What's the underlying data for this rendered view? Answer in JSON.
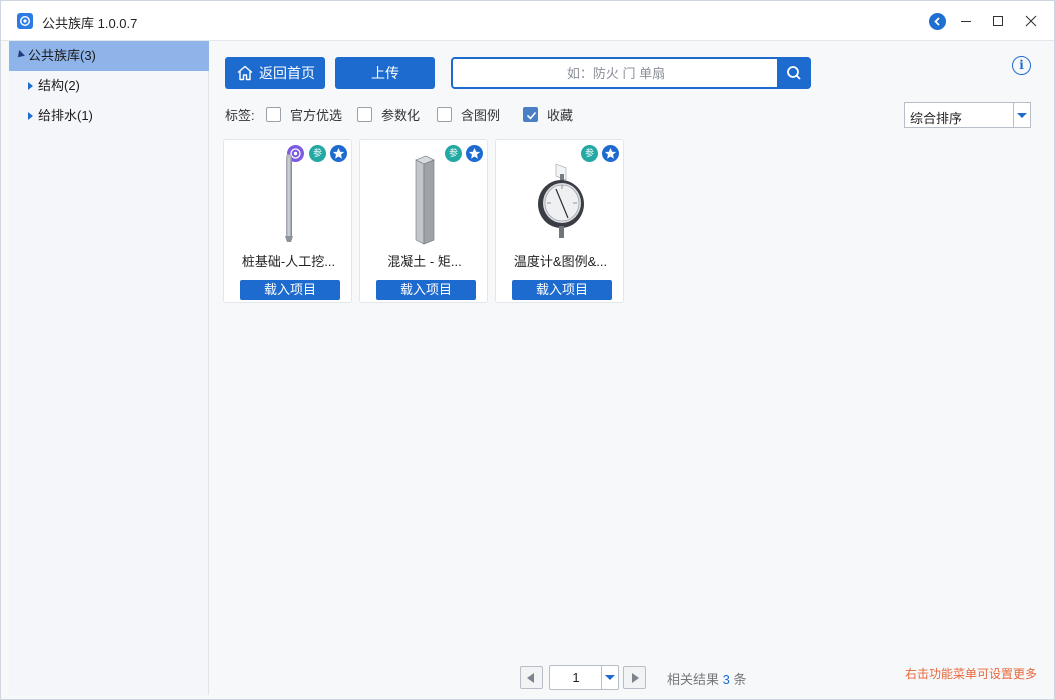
{
  "window": {
    "title": "公共族库 1.0.0.7"
  },
  "sidebar": {
    "root": {
      "label": "公共族库(3)"
    },
    "items": [
      {
        "label": "结构(2)"
      },
      {
        "label": "给排水(1)"
      }
    ]
  },
  "toolbar": {
    "home_label": "返回首页",
    "upload_label": "上传",
    "search_placeholder": "如：防火 门 单扇"
  },
  "tags": {
    "label": "标签:",
    "options": [
      {
        "label": "官方优选",
        "checked": false
      },
      {
        "label": "参数化",
        "checked": false
      },
      {
        "label": "含图例",
        "checked": false
      },
      {
        "label": "收藏",
        "checked": true
      }
    ]
  },
  "sort": {
    "selected": "综合排序"
  },
  "cards": [
    {
      "name": "桩基础-人工挖...",
      "button": "载入项目",
      "badges": [
        "official",
        "param",
        "fav"
      ],
      "param_badge": "参"
    },
    {
      "name": "混凝土 - 矩...",
      "button": "载入项目",
      "badges": [
        "param",
        "fav"
      ],
      "param_badge": "参"
    },
    {
      "name": "温度计&图例&...",
      "button": "载入项目",
      "badges": [
        "param",
        "fav"
      ],
      "param_badge": "参"
    }
  ],
  "pager": {
    "page": "1",
    "result_prefix": "相关结果",
    "result_count": "3",
    "result_suffix": "条"
  },
  "hint": "右击功能菜单可设置更多",
  "colors": {
    "primary": "#1e6bd0",
    "selected_tree": "#8fb4ea",
    "hint": "#e8673b",
    "official_badge": "#7b5ce0",
    "param_badge": "#23a8a3"
  },
  "icons": [
    "app-logo-icon",
    "back-circle-icon",
    "minimize-icon",
    "maximize-icon",
    "close-icon",
    "home-icon",
    "search-icon",
    "info-icon",
    "star-icon",
    "check-icon"
  ]
}
